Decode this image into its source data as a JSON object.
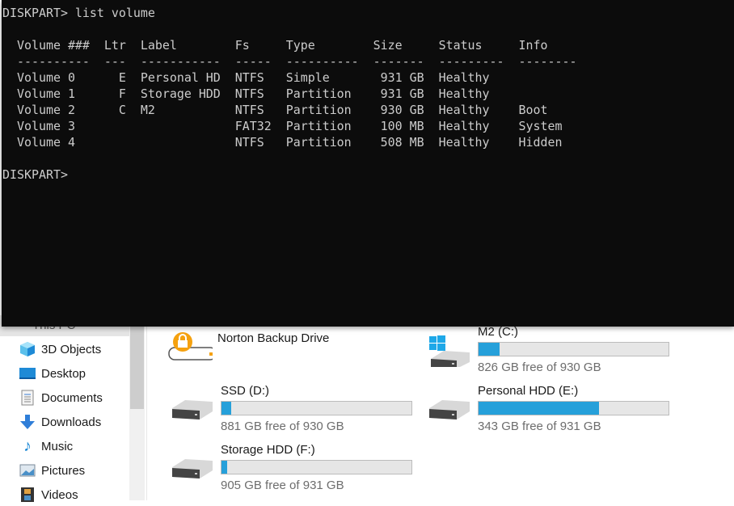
{
  "console": {
    "command_line": "DISKPART> list volume",
    "headers": [
      "Volume ###",
      "Ltr",
      "Label",
      "Fs",
      "Type",
      "Size",
      "Status",
      "Info"
    ],
    "rows": [
      [
        "Volume 0",
        "E",
        "Personal HD",
        "NTFS",
        "Simple",
        "931 GB",
        "Healthy",
        ""
      ],
      [
        "Volume 1",
        "F",
        "Storage HDD",
        "NTFS",
        "Partition",
        "931 GB",
        "Healthy",
        ""
      ],
      [
        "Volume 2",
        "C",
        "M2",
        "NTFS",
        "Partition",
        "930 GB",
        "Healthy",
        "Boot"
      ],
      [
        "Volume 3",
        "",
        "",
        "FAT32",
        "Partition",
        "100 MB",
        "Healthy",
        "System"
      ],
      [
        "Volume 4",
        "",
        "",
        "NTFS",
        "Partition",
        "508 MB",
        "Healthy",
        "Hidden"
      ]
    ],
    "prompt": "DISKPART> "
  },
  "sidebar": {
    "this_pc": "This PC",
    "items": [
      {
        "label": "3D Objects",
        "icon": "cube-icon"
      },
      {
        "label": "Desktop",
        "icon": "desktop-icon"
      },
      {
        "label": "Documents",
        "icon": "document-icon"
      },
      {
        "label": "Downloads",
        "icon": "download-arrow-icon"
      },
      {
        "label": "Music",
        "icon": "music-note-icon"
      },
      {
        "label": "Pictures",
        "icon": "picture-icon"
      },
      {
        "label": "Videos",
        "icon": "film-icon"
      }
    ]
  },
  "drives": [
    {
      "name": "Norton Backup Drive",
      "icon": "norton-lock-drive-icon"
    },
    {
      "name": "M2 (C:)",
      "free": "826 GB free of 930 GB",
      "used_percent": 11.2,
      "icon": "windows-drive-icon"
    },
    {
      "name": "SSD (D:)",
      "free": "881 GB free of 930 GB",
      "used_percent": 5.3,
      "icon": "drive-icon"
    },
    {
      "name": "Personal HDD (E:)",
      "free": "343 GB free of 931 GB",
      "used_percent": 63.2,
      "icon": "drive-icon"
    },
    {
      "name": "Storage HDD (F:)",
      "free": "905 GB free of 931 GB",
      "used_percent": 2.8,
      "icon": "drive-icon"
    }
  ],
  "colors": {
    "bar_fill": "#26a0da",
    "console_bg": "#0c0c0c",
    "console_text": "#cccccc",
    "norton": "#f5a10f"
  }
}
